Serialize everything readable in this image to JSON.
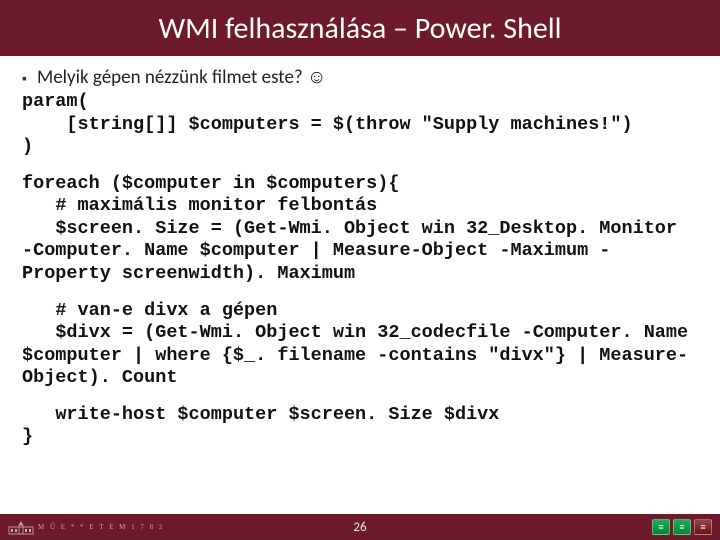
{
  "title": "WMI felhasználása – Power. Shell",
  "bullet_text": "Melyik gépen nézzünk filmet este? ☺",
  "code_block1": "param(\n    [string[]] $computers = $(throw \"Supply machines!\")\n)",
  "code_block2": "foreach ($computer in $computers){\n   # maximális monitor felbontás\n   $screen. Size = (Get-Wmi. Object win 32_Desktop. Monitor -Computer. Name $computer | Measure-Object -Maximum -Property screenwidth). Maximum",
  "code_block3": "   # van-e divx a gépen\n   $divx = (Get-Wmi. Object win 32_codecfile -Computer. Name $computer | where {$_. filename -contains \"divx\"} | Measure-Object). Count",
  "code_block4": "   write-host $computer $screen. Size $divx\n}",
  "footer": {
    "uni_text": "M Ű E * * E T E M  1 7 8 2",
    "page_number": "26",
    "badges": [
      "≡",
      "≡",
      "≡"
    ]
  }
}
